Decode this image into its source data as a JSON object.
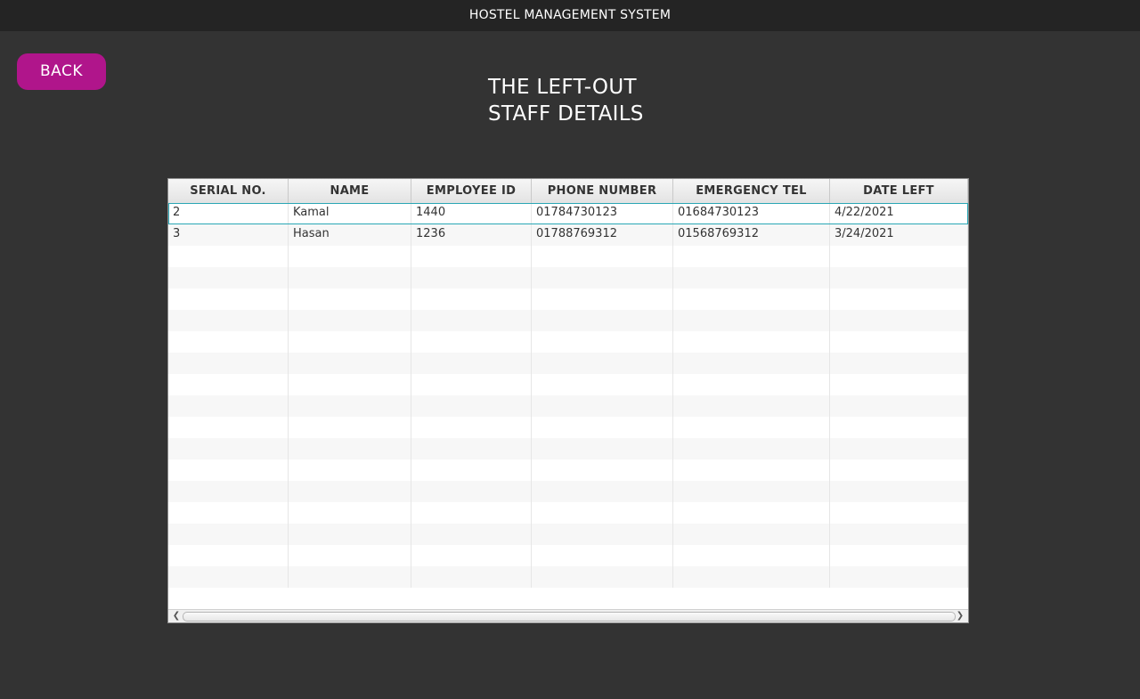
{
  "window": {
    "title": "HOSTEL MANAGEMENT SYSTEM"
  },
  "actions": {
    "back_label": "BACK"
  },
  "page": {
    "title_line1": "THE LEFT-OUT",
    "title_line2": "STAFF DETAILS"
  },
  "table": {
    "columns": [
      "SERIAL NO.",
      "NAME",
      "EMPLOYEE ID",
      "PHONE NUMBER",
      "EMERGENCY TEL",
      "DATE LEFT"
    ],
    "rows": [
      [
        "2",
        "Kamal",
        "1440",
        "01784730123",
        "01684730123",
        "4/22/2021"
      ],
      [
        "3",
        "Hasan",
        "1236",
        "01788769312",
        "01568769312",
        "3/24/2021"
      ]
    ],
    "selected_row": 0
  },
  "colors": {
    "background": "#333333",
    "titlebar": "#242424",
    "accent": "#b0158b",
    "selection_border": "#2aa7b5"
  },
  "icons": {
    "scroll_left": "chevron-left-icon",
    "scroll_right": "chevron-right-icon"
  }
}
